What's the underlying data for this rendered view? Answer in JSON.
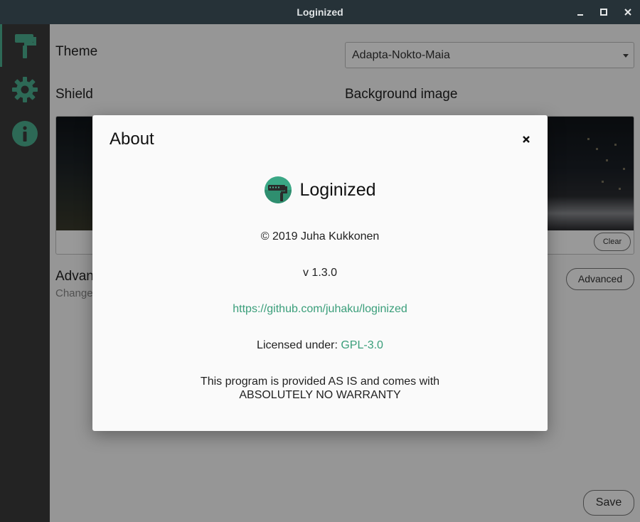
{
  "window": {
    "title": "Loginized",
    "controls": [
      "minimize-icon",
      "maximize-icon",
      "close-icon"
    ]
  },
  "sidebar": {
    "items": [
      {
        "icon": "paint-roller-icon",
        "active": true
      },
      {
        "icon": "gear-icon",
        "active": false
      },
      {
        "icon": "info-icon",
        "active": false
      }
    ]
  },
  "main": {
    "theme_label": "Theme",
    "theme_value": "Adapta-Nokto-Maia",
    "shield_label": "Shield",
    "background_label": "Background image",
    "clear_label": "Clear",
    "advanced_heading": "Advan",
    "advanced_sub": "Change",
    "advanced_button": "Advanced",
    "save_button": "Save"
  },
  "about": {
    "title": "About",
    "app_name": "Loginized",
    "copyright": "© 2019 Juha Kukkonen",
    "version": "v 1.3.0",
    "url": "https://github.com/juhaku/loginized",
    "license_prefix": "Licensed under: ",
    "license": "GPL-3.0",
    "warranty_line1": "This program is provided AS IS and comes with",
    "warranty_line2": "ABSOLUTELY NO WARRANTY"
  },
  "colors": {
    "titlebar": "#263238",
    "sidebar": "#3b3b3b",
    "accent": "#4caf90",
    "link": "#3a9e7a"
  }
}
